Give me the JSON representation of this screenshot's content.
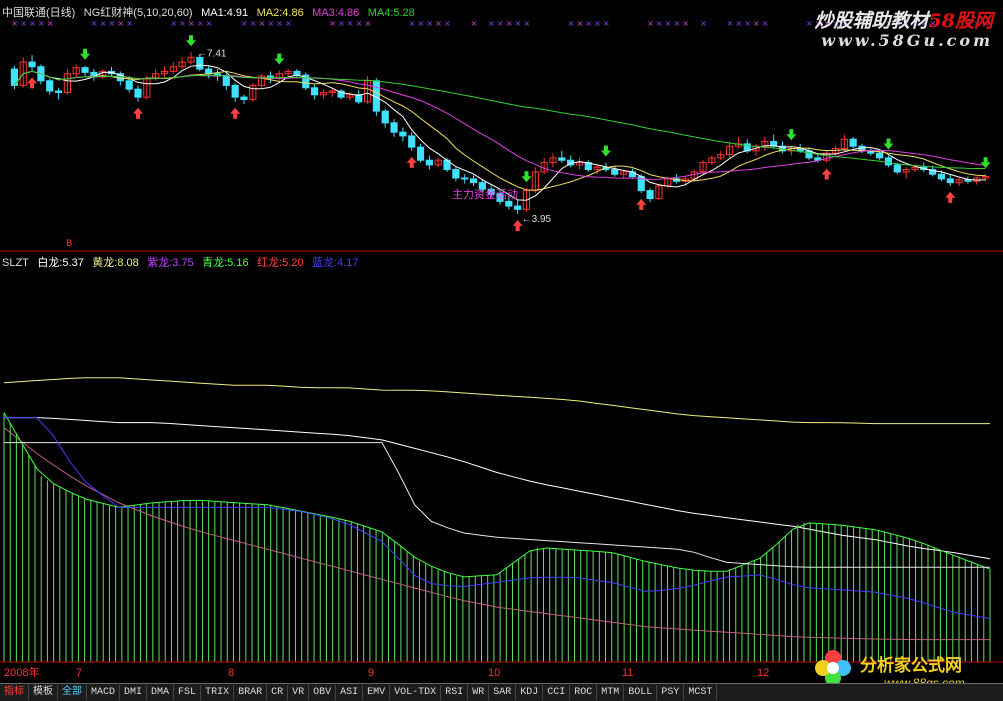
{
  "colors": {
    "bg": "#000000",
    "up": "#ff3030",
    "down": "#40e0ff",
    "ma1": "#ffffff",
    "ma2": "#f0e060",
    "ma3": "#e040e0",
    "ma4": "#30d030",
    "white_dragon": "#ffffff",
    "yellow_dragon": "#f0f080",
    "purple_dragon": "#c040ff",
    "cyan_dragon": "#40ff40",
    "red_dragon": "#ff4040",
    "blue_dragon": "#4040ff",
    "green_hist": "#60e060",
    "pink_line": "#c06080",
    "dash": "#c00000",
    "axis_text": "#ff3030"
  },
  "header": {
    "stock": "中国联通(日线)",
    "indicator": "NG红财神(5,10,20,60)",
    "ma1": "MA1:4.91",
    "ma2": "MA2:4.86",
    "ma3": "MA3:4.86",
    "ma4": "MA4:5.28"
  },
  "indicator_header": {
    "name": "SLZT",
    "white": "白龙:5.37",
    "yellow": "黄龙:8.08",
    "purple": "紫龙:3.75",
    "cyan": "青龙:5.16",
    "red": "红龙:5.20",
    "blue": "蓝龙:4.17"
  },
  "annotations": {
    "high_label": "7.41",
    "low_label": "3.95",
    "main_activity": "主力资金活动",
    "signal_mark": "B"
  },
  "watermarks": {
    "site1_black": "炒股辅助教材",
    "site1_red": "58股网",
    "site1_url": "www.58Gu.com",
    "site2_name": "分析家公式网",
    "site2_url": "www.88gs.com"
  },
  "x_axis": {
    "year": "2008年",
    "months": [
      "7",
      "8",
      "9",
      "10",
      "11",
      "12"
    ]
  },
  "tabs": [
    "指标",
    "模板",
    "全部",
    "MACD",
    "DMI",
    "DMA",
    "FSL",
    "TRIX",
    "BRAR",
    "CR",
    "VR",
    "OBV",
    "ASI",
    "EMV",
    "VOL-TDX",
    "RSI",
    "WR",
    "SAR",
    "KDJ",
    "CCI",
    "ROC",
    "MTM",
    "BOLL",
    "PSY",
    "MCST"
  ],
  "chart_data": [
    {
      "type": "candlestick",
      "title": "中国联通(日线)",
      "note": "daily OHLC estimated from the screenshot, Jun–Dec 2008",
      "ohlc": [
        [
          7.05,
          7.12,
          6.62,
          6.7
        ],
        [
          6.7,
          7.3,
          6.65,
          7.2
        ],
        [
          7.2,
          7.35,
          7.0,
          7.1
        ],
        [
          7.1,
          7.15,
          6.72,
          6.8
        ],
        [
          6.8,
          6.85,
          6.5,
          6.58
        ],
        [
          6.58,
          6.65,
          6.4,
          6.55
        ],
        [
          6.55,
          7.05,
          6.5,
          6.95
        ],
        [
          6.95,
          7.15,
          6.88,
          7.08
        ],
        [
          7.08,
          7.12,
          6.9,
          6.98
        ],
        [
          6.98,
          7.05,
          6.8,
          6.88
        ],
        [
          6.88,
          7.05,
          6.85,
          7.0
        ],
        [
          7.0,
          7.1,
          6.9,
          6.95
        ],
        [
          6.95,
          7.0,
          6.7,
          6.8
        ],
        [
          6.8,
          6.9,
          6.55,
          6.62
        ],
        [
          6.62,
          6.7,
          6.35,
          6.45
        ],
        [
          6.45,
          6.9,
          6.4,
          6.85
        ],
        [
          6.85,
          7.05,
          6.8,
          6.95
        ],
        [
          6.95,
          7.1,
          6.88,
          7.0
        ],
        [
          7.0,
          7.2,
          6.95,
          7.1
        ],
        [
          7.1,
          7.3,
          7.05,
          7.2
        ],
        [
          7.2,
          7.41,
          7.15,
          7.3
        ],
        [
          7.3,
          7.35,
          7.0,
          7.05
        ],
        [
          7.05,
          7.12,
          6.85,
          6.95
        ],
        [
          6.95,
          7.05,
          6.8,
          6.9
        ],
        [
          6.9,
          6.95,
          6.6,
          6.7
        ],
        [
          6.7,
          6.75,
          6.35,
          6.45
        ],
        [
          6.45,
          6.5,
          6.3,
          6.4
        ],
        [
          6.4,
          6.75,
          6.35,
          6.7
        ],
        [
          6.7,
          6.95,
          6.65,
          6.9
        ],
        [
          6.9,
          7.0,
          6.75,
          6.85
        ],
        [
          6.85,
          7.02,
          6.8,
          6.95
        ],
        [
          6.95,
          7.05,
          6.85,
          7.0
        ],
        [
          7.0,
          7.05,
          6.85,
          6.92
        ],
        [
          6.92,
          6.98,
          6.6,
          6.65
        ],
        [
          6.65,
          6.72,
          6.4,
          6.5
        ],
        [
          6.5,
          6.62,
          6.42,
          6.55
        ],
        [
          6.55,
          6.65,
          6.45,
          6.58
        ],
        [
          6.58,
          6.62,
          6.4,
          6.45
        ],
        [
          6.45,
          6.55,
          6.38,
          6.5
        ],
        [
          6.5,
          6.6,
          6.3,
          6.35
        ],
        [
          6.35,
          6.9,
          6.3,
          6.8
        ],
        [
          6.8,
          6.85,
          6.05,
          6.15
        ],
        [
          6.15,
          6.2,
          5.8,
          5.9
        ],
        [
          5.9,
          5.98,
          5.6,
          5.7
        ],
        [
          5.7,
          5.8,
          5.5,
          5.62
        ],
        [
          5.62,
          5.7,
          5.3,
          5.38
        ],
        [
          5.38,
          5.45,
          5.05,
          5.1
        ],
        [
          5.1,
          5.2,
          4.9,
          5.0
        ],
        [
          5.0,
          5.15,
          4.95,
          5.1
        ],
        [
          5.1,
          5.15,
          4.85,
          4.9
        ],
        [
          4.9,
          4.95,
          4.65,
          4.72
        ],
        [
          4.72,
          4.8,
          4.6,
          4.7
        ],
        [
          4.7,
          4.78,
          4.55,
          4.62
        ],
        [
          4.62,
          4.7,
          4.4,
          4.48
        ],
        [
          4.48,
          4.55,
          4.3,
          4.38
        ],
        [
          4.38,
          4.45,
          4.15,
          4.22
        ],
        [
          4.22,
          4.3,
          4.05,
          4.12
        ],
        [
          4.12,
          4.25,
          3.95,
          4.05
        ],
        [
          4.05,
          4.5,
          4.0,
          4.45
        ],
        [
          4.45,
          4.95,
          4.4,
          4.85
        ],
        [
          4.85,
          5.15,
          4.8,
          5.05
        ],
        [
          5.05,
          5.25,
          4.95,
          5.15
        ],
        [
          5.15,
          5.3,
          5.05,
          5.1
        ],
        [
          5.1,
          5.2,
          4.95,
          5.0
        ],
        [
          5.0,
          5.15,
          4.9,
          5.05
        ],
        [
          5.05,
          5.1,
          4.85,
          4.9
        ],
        [
          4.9,
          5.0,
          4.8,
          4.95
        ],
        [
          4.95,
          5.05,
          4.85,
          4.9
        ],
        [
          4.9,
          4.98,
          4.75,
          4.8
        ],
        [
          4.8,
          4.9,
          4.7,
          4.85
        ],
        [
          4.85,
          4.92,
          4.7,
          4.75
        ],
        [
          4.75,
          4.8,
          4.4,
          4.45
        ],
        [
          4.45,
          4.5,
          4.2,
          4.28
        ],
        [
          4.28,
          4.6,
          4.25,
          4.55
        ],
        [
          4.55,
          4.75,
          4.5,
          4.7
        ],
        [
          4.7,
          4.8,
          4.6,
          4.65
        ],
        [
          4.65,
          4.75,
          4.55,
          4.7
        ],
        [
          4.7,
          4.9,
          4.65,
          4.85
        ],
        [
          4.85,
          5.1,
          4.8,
          5.05
        ],
        [
          5.05,
          5.2,
          5.0,
          5.15
        ],
        [
          5.15,
          5.3,
          5.1,
          5.22
        ],
        [
          5.22,
          5.5,
          5.15,
          5.4
        ],
        [
          5.4,
          5.6,
          5.35,
          5.45
        ],
        [
          5.45,
          5.55,
          5.25,
          5.3
        ],
        [
          5.3,
          5.45,
          5.2,
          5.4
        ],
        [
          5.4,
          5.6,
          5.3,
          5.5
        ],
        [
          5.5,
          5.65,
          5.35,
          5.4
        ],
        [
          5.4,
          5.5,
          5.25,
          5.3
        ],
        [
          5.3,
          5.4,
          5.2,
          5.35
        ],
        [
          5.35,
          5.45,
          5.25,
          5.3
        ],
        [
          5.3,
          5.38,
          5.1,
          5.15
        ],
        [
          5.15,
          5.25,
          5.05,
          5.1
        ],
        [
          5.1,
          5.3,
          5.05,
          5.25
        ],
        [
          5.25,
          5.4,
          5.2,
          5.35
        ],
        [
          5.35,
          5.65,
          5.3,
          5.55
        ],
        [
          5.55,
          5.6,
          5.35,
          5.4
        ],
        [
          5.4,
          5.45,
          5.25,
          5.3
        ],
        [
          5.3,
          5.35,
          5.2,
          5.25
        ],
        [
          5.25,
          5.3,
          5.1,
          5.15
        ],
        [
          5.15,
          5.2,
          4.95,
          5.0
        ],
        [
          5.0,
          5.05,
          4.8,
          4.85
        ],
        [
          4.85,
          4.95,
          4.7,
          4.9
        ],
        [
          4.9,
          5.0,
          4.85,
          4.95
        ],
        [
          4.95,
          5.05,
          4.85,
          4.9
        ],
        [
          4.9,
          4.98,
          4.75,
          4.8
        ],
        [
          4.8,
          4.88,
          4.65,
          4.7
        ],
        [
          4.7,
          4.78,
          4.55,
          4.62
        ],
        [
          4.62,
          4.72,
          4.55,
          4.68
        ],
        [
          4.68,
          4.75,
          4.6,
          4.65
        ],
        [
          4.65,
          4.75,
          4.58,
          4.72
        ],
        [
          4.72,
          4.8,
          4.65,
          4.75
        ]
      ],
      "ma_periods": [
        5,
        10,
        20,
        60
      ],
      "ylim": [
        3.5,
        8.1
      ],
      "high_label": 7.41,
      "low_label": 3.95
    },
    {
      "type": "line",
      "title": "SLZT",
      "note": "dragon lines and green histogram estimated from screenshot",
      "series": [
        {
          "name": "白龙",
          "values": [
            8.2,
            8.2,
            8.15,
            8.1,
            8.1,
            8.05,
            8.0,
            7.95,
            7.9,
            7.85,
            7.75,
            7.55,
            7.35,
            7.1,
            6.9,
            6.75,
            6.6,
            6.45,
            6.3,
            6.2,
            6.1,
            6.0,
            5.85,
            5.75,
            5.6,
            5.5,
            5.37
          ]
        },
        {
          "name": "黄龙",
          "values": [
            8.9,
            8.95,
            9.0,
            9.0,
            8.95,
            8.9,
            8.85,
            8.85,
            8.8,
            8.8,
            8.75,
            8.75,
            8.7,
            8.65,
            8.6,
            8.55,
            8.45,
            8.35,
            8.25,
            8.2,
            8.15,
            8.1,
            8.1,
            8.08,
            8.08,
            8.08,
            8.08
          ]
        },
        {
          "name": "紫龙",
          "values": [
            8.0,
            7.4,
            6.9,
            6.5,
            6.2,
            5.95,
            5.75,
            5.55,
            5.35,
            5.15,
            4.95,
            4.75,
            4.55,
            4.4,
            4.3,
            4.2,
            4.1,
            4.0,
            3.95,
            3.9,
            3.85,
            3.8,
            3.78,
            3.76,
            3.75,
            3.75,
            3.75
          ]
        },
        {
          "name": "青龙",
          "values": [
            8.3,
            7.0,
            6.6,
            6.4,
            6.5,
            6.55,
            6.5,
            6.45,
            6.3,
            6.15,
            5.9,
            5.3,
            5.0,
            5.05,
            5.6,
            5.55,
            5.5,
            5.3,
            5.15,
            5.1,
            5.4,
            6.1,
            6.05,
            5.95,
            5.75,
            5.45,
            5.16
          ]
        },
        {
          "name": "红龙",
          "values": [
            7.7,
            7.7,
            7.7,
            7.7,
            7.7,
            7.7,
            7.7,
            7.7,
            7.7,
            7.7,
            7.7,
            6.2,
            5.9,
            5.8,
            5.75,
            5.7,
            5.65,
            5.6,
            5.55,
            5.3,
            5.25,
            5.2,
            5.2,
            5.2,
            5.2,
            5.2,
            5.2
          ]
        },
        {
          "name": "蓝龙",
          "values": [
            8.2,
            8.2,
            7.0,
            6.4,
            6.4,
            6.4,
            6.4,
            6.4,
            6.3,
            6.1,
            5.7,
            4.9,
            4.8,
            4.9,
            5.0,
            5.0,
            4.9,
            4.7,
            4.8,
            5.0,
            5.05,
            4.8,
            4.75,
            4.7,
            4.55,
            4.3,
            4.17
          ]
        }
      ],
      "ylim": [
        3.3,
        11.2
      ]
    }
  ]
}
